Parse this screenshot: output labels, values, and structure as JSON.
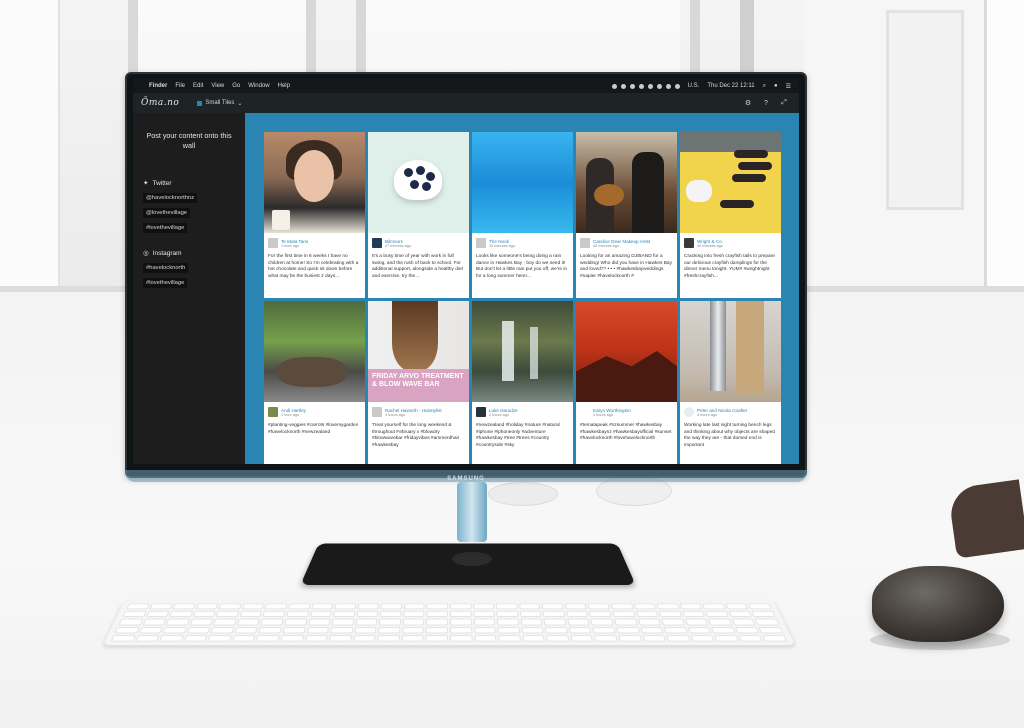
{
  "menubar": {
    "app_name": "Finder",
    "items": [
      "File",
      "Edit",
      "View",
      "Go",
      "Window",
      "Help"
    ],
    "locale": "U.S.",
    "clock": "Thu Dec 22  12:11"
  },
  "appbar": {
    "logo": "Ōma.no",
    "theme_label": "Small Tiles",
    "icons": [
      "gear-icon",
      "help-icon",
      "fullscreen-icon"
    ]
  },
  "sidebar": {
    "title": "Post your content onto this wall",
    "twitter": {
      "label": "Twitter",
      "tags": [
        "@havelocknorthnz",
        "@lovethevillage",
        "#lovethevillage"
      ]
    },
    "instagram": {
      "label": "Instagram",
      "tags": [
        "#havelocknorth",
        "#lovethevillage"
      ]
    }
  },
  "cards": [
    {
      "author": "Te Mata Tans",
      "time": "1 hour ago",
      "text": "For the first time in 6 weeks I have no children at home! So I'm celebrating with a hot chocolate and quick sit down before what may be the busiest 2 days..."
    },
    {
      "author": "Bilmours",
      "time": "47 minutes ago",
      "text": "It's a busy time of year with work in full swing, and the rush of back to school. For additional support, alongside a healthy diet and exercise, try the..."
    },
    {
      "author": "The Nook",
      "time": "15 minutes ago",
      "text": "Looks like someone's being doing a rain dance in Hawkes Bay - boy do we need it! But don't let a little rain put you off, we're in for a long summer here!..."
    },
    {
      "author": "Candice Dear Makeup Artist",
      "time": "40 minutes ago",
      "text": "Looking for an amazing DJ/BAND for a wedding! Who did you have in Hawkes Bay and loved?? • • • #hawkesbayweddings #napier #havelocknorth #"
    },
    {
      "author": "Wright & Co.",
      "time": "40 minutes ago",
      "text": "Cracking into fresh crayfish tails to prepare our delicious crayfish dumplings for the dinner menu tonight. YUM!! #wrightnight #freshcrayfish..."
    },
    {
      "author": "Andi Hartley",
      "time": "1 hour ago",
      "text": "#planting-veggies #carrots #lovemygarden #havelocknorth #newzealand"
    },
    {
      "author": "Rachel Haworth - Hairstylist",
      "time": "4 hours ago",
      "text": "Treat yourself for the long weekend & throughout February x #blowdry #blowwavebar #fridayvibes #ammerdhair #hawkesbay",
      "banner": "FRIDAY ARVO TREATMENT & BLOW WAVE BAR"
    },
    {
      "author": "Luke Daradze",
      "time": "2 hours ago",
      "text": "#newzealand #holiday #nature #natural #iphone #iphoneonly #adventure #hawkesbay #tree #trees #country #countryside #sky"
    },
    {
      "author": "Karyn Worthington",
      "time": "4 hours ago",
      "text": "#tematapeak #nzsummer #hawkesbay #hawkesbaynz #hawkesbayofficial #sunset #havelocknorth #lovehavelocknorth"
    },
    {
      "author": "Peter and Nicola Coafter",
      "time": "4 hours ago",
      "text": "Working late last night turning bench legs and thinking about why objects are shaped the way they are - that domed end is important"
    }
  ],
  "colors": {
    "wall_background": "#2a85b3",
    "sidebar_background": "#1d1d1d",
    "author_link": "#2a85b3"
  },
  "hardware": {
    "monitor_brand": "SAMSUNG"
  }
}
